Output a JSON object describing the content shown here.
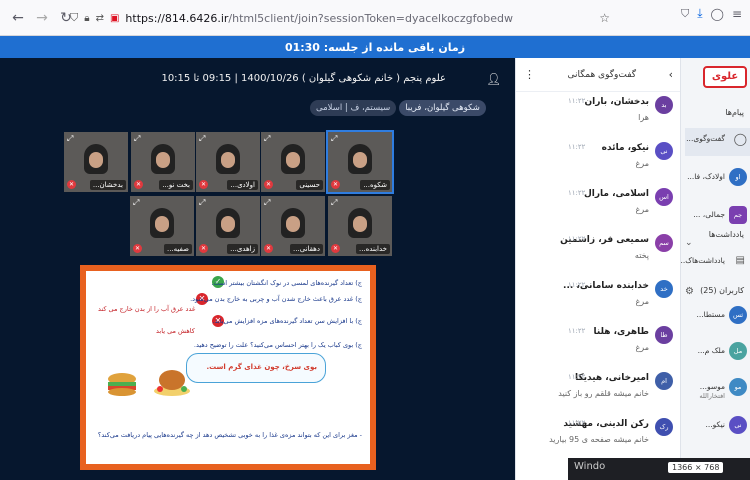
{
  "browser": {
    "url_prefix": "https://814.6426.ir",
    "url_rest": "/html5client/join?sessionToken=dyacelkoczgfobedw"
  },
  "timer": "زمان باقی مانده از جلسه: 01:30",
  "meeting": {
    "title": "علوم پنجم ( خانم شکوهی گیلوان ) 1400/10/26 | 09:15 تا 10:15",
    "pills": [
      "شکوهی گیلوان، فریبا",
      "سیستم، ف | اسلامی"
    ]
  },
  "videos": [
    {
      "name": "بدخشان..."
    },
    {
      "name": "بخت نو..."
    },
    {
      "name": "اولادی..."
    },
    {
      "name": "حسینی"
    },
    {
      "name": "شکوه..."
    },
    {
      "name": "صفیه..."
    },
    {
      "name": "زاهدی..."
    },
    {
      "name": "دهقانی..."
    },
    {
      "name": "خدابنده..."
    }
  ],
  "slide": {
    "lines": [
      "ج) تعداد گیرنده‌های لمسی در نوک انگشتان بیشتر است.",
      "ج) غدد عرق باعث خارج شدن آب و چربی به خارج بدن می‌شود.",
      "ج) با افزایش سن تعداد گیرنده‌های مزه افزایش می‌یابد.",
      "ج) بوی کباب یک را بهتر احساس می‌کنید؟ علت را توضیح دهید."
    ],
    "answers": [
      "غدد عرق آب را از بدن خارج می کند",
      "کاهش می یابد"
    ],
    "bubble_text": "بوی سرخ، چون غذای گرم است.",
    "bottom_question": "- مغز برای این که بتواند مزه‌ی غذا را به خوبی تشخیص دهد از چه گیرنده‌هایی پیام دریافت می‌کند؟"
  },
  "chat": {
    "title": "گفت‌وگوی همگانی",
    "messages": [
      {
        "initials": "بد",
        "sender": "بدخشان، باران",
        "time": "۱۱:۲۲",
        "text": "هرا",
        "color": "#6b3fa0"
      },
      {
        "initials": "نی",
        "sender": "نیکو، مائده",
        "time": "۱۱:۲۲",
        "text": "مرغ",
        "color": "#5a4fc4"
      },
      {
        "initials": "اس",
        "sender": "اسلامی، مارال",
        "time": "۱۱:۲۲",
        "text": "مرغ",
        "color": "#7a3fb0"
      },
      {
        "initials": "سم",
        "sender": "سمیعی فر، زاسمین",
        "time": "۱۱:۲۲",
        "text": "پخته",
        "color": "#8a3fa8"
      },
      {
        "initials": "خد",
        "sender": "خدابنده سامانی، ...",
        "time": "۱۱:۲۲",
        "text": "مرغ",
        "color": "#2f6fc4"
      },
      {
        "initials": "طا",
        "sender": "طاهری، هلنا",
        "time": "۱۱:۲۲",
        "text": "مرغ",
        "color": "#6b3fa0"
      },
      {
        "initials": "ام",
        "sender": "امیرخانی، هیدیکا",
        "time": "۱۱:۲۲",
        "text": "خانم میشه قلقم رو باز کنید",
        "color": "#3f5fa8"
      },
      {
        "initials": "رک",
        "sender": "رکن الدینی، مهشید",
        "time": "۱۱:۲۲",
        "text": "خانم میشه صفحه ی 95 بیارید",
        "color": "#3f4fb0"
      }
    ]
  },
  "sidebar": {
    "logo": "علوی",
    "messages_label": "پیام‌ها",
    "public_chat": "گفت‌وگوی...",
    "notes_label": "یادداشت‌ها",
    "shared_notes": "یادداشت‌هاک...",
    "users_label": "کاربران (25)",
    "users": [
      {
        "initials": "او",
        "name": "اولادک، فا...",
        "sub": "",
        "color": "#2f6fc4"
      },
      {
        "initials": "جم",
        "name": "جمالی، ...",
        "sub": "",
        "color": "#7a3fb0"
      },
      {
        "initials": "ثس",
        "name": "مستطا...",
        "sub": "",
        "color": "#2f6fc4"
      },
      {
        "initials": "مل",
        "name": "ملک م...",
        "sub": "",
        "color": "#4aa3a0"
      },
      {
        "initials": "مو",
        "name": "موسو...",
        "sub": "افتخارالله",
        "color": "#3f8ac4"
      },
      {
        "initials": "نی",
        "name": "نیکو...",
        "sub": "",
        "color": "#5a4fc4"
      }
    ]
  },
  "taskbar": {
    "label": "Windo",
    "resolution": "1366 × 768"
  }
}
